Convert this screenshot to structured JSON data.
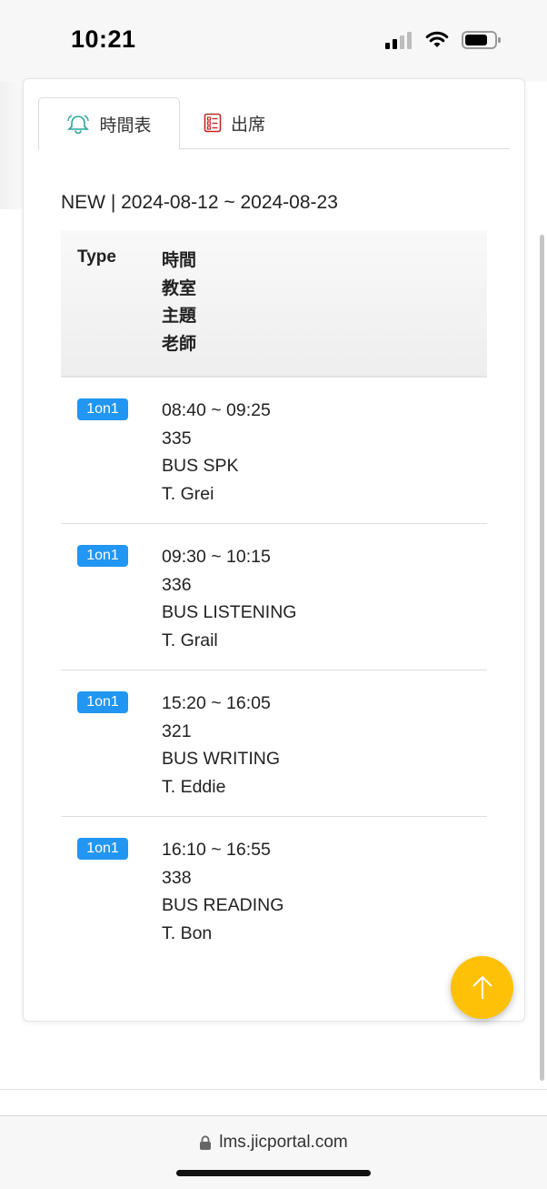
{
  "status": {
    "time": "10:21"
  },
  "tabs": [
    {
      "label": "時間表",
      "icon": "bell-icon"
    },
    {
      "label": "出席",
      "icon": "checklist-icon"
    }
  ],
  "schedule": {
    "title": "NEW | 2024-08-12 ~ 2024-08-23",
    "headers": {
      "type": "Type",
      "lines": [
        "時間",
        "教室",
        "主題",
        "老師"
      ]
    },
    "rows": [
      {
        "type": "1on1",
        "time": "08:40 ~ 09:25",
        "room": "335",
        "subject": "BUS SPK",
        "teacher": "T. Grei"
      },
      {
        "type": "1on1",
        "time": "09:30 ~ 10:15",
        "room": "336",
        "subject": "BUS LISTENING",
        "teacher": "T. Grail"
      },
      {
        "type": "1on1",
        "time": "15:20 ~ 16:05",
        "room": "321",
        "subject": "BUS WRITING",
        "teacher": "T. Eddie"
      },
      {
        "type": "1on1",
        "time": "16:10 ~ 16:55",
        "room": "338",
        "subject": "BUS READING",
        "teacher": "T. Bon"
      }
    ]
  },
  "browser": {
    "url": "lms.jicportal.com"
  },
  "colors": {
    "badge": "#2196f3",
    "fab": "#ffc107",
    "bell_icon": "#26a69a",
    "checklist_icon": "#c62828"
  }
}
